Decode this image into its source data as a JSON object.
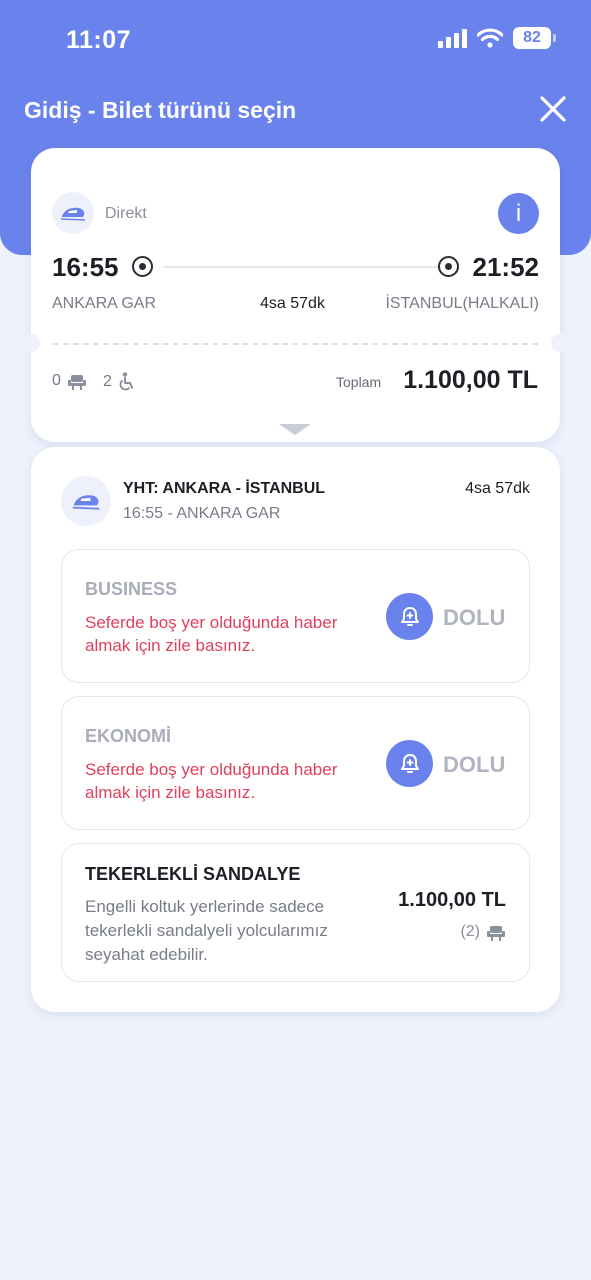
{
  "status_bar": {
    "time": "11:07",
    "battery": "82"
  },
  "header": {
    "title": "Gidiş - Bilet türünü seçin",
    "close_icon": "close-icon"
  },
  "summary": {
    "type_label": "Direkt",
    "info_label": "i",
    "departure_time": "16:55",
    "arrival_time": "21:52",
    "departure_station": "ANKARA GAR",
    "arrival_station": "İSTANBUL(HALKALI)",
    "duration": "4sa 57dk",
    "passengers": {
      "seat_count": "0",
      "wheelchair_count": "2"
    },
    "total_label": "Toplam",
    "total_value": "1.100,00 TL"
  },
  "train": {
    "name": "YHT: ANKARA - İSTANBUL",
    "duration": "4sa 57dk",
    "departure": "16:55 - ANKARA GAR"
  },
  "classes": [
    {
      "title": "BUSINESS",
      "message": "Seferde boş yer olduğunda haber almak için zile basınız.",
      "status": "DOLU"
    },
    {
      "title": "EKONOMİ",
      "message": "Seferde boş yer olduğunda haber almak için zile basınız.",
      "status": "DOLU"
    }
  ],
  "wheelchair": {
    "title": "TEKERLEKLİ SANDALYE",
    "description": "Engelli koltuk yerlerinde sadece tekerlekli sandalyeli yolcularımız seyahat edebilir.",
    "price": "1.100,00 TL",
    "seats": "(2)"
  },
  "colors": {
    "primary": "#6a83ec",
    "alert": "#e0405e",
    "muted": "#b0b4bf",
    "background": "#eff2fc"
  }
}
